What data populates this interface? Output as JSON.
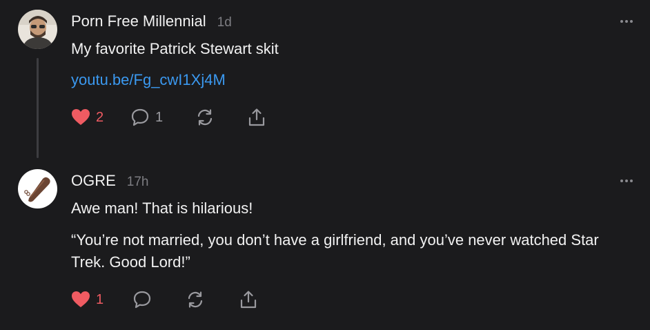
{
  "comments": [
    {
      "author": "Porn Free Millennial",
      "time": "1d",
      "text": "My favorite Patrick Stewart skit",
      "link": "youtu.be/Fg_cwI1Xj4M",
      "likes": "2",
      "replies": "1",
      "liked": true
    },
    {
      "author": "OGRE",
      "time": "17h",
      "text": "Awe man! That is hilarious!",
      "quote": "“You’re not married, you don’t have a girlfriend, and you’ve never watched Star Trek. Good Lord!”",
      "likes": "1",
      "liked": true
    }
  ],
  "icons": {
    "like": "heart-icon",
    "reply": "comment-bubble-icon",
    "restack": "restack-arrows-icon",
    "share": "share-upload-icon",
    "more": "more-dots-icon"
  },
  "colors": {
    "background": "#1b1b1d",
    "text": "#f2f2f2",
    "muted": "#7d7d82",
    "link": "#3b99f0",
    "like": "#ef5b62"
  }
}
